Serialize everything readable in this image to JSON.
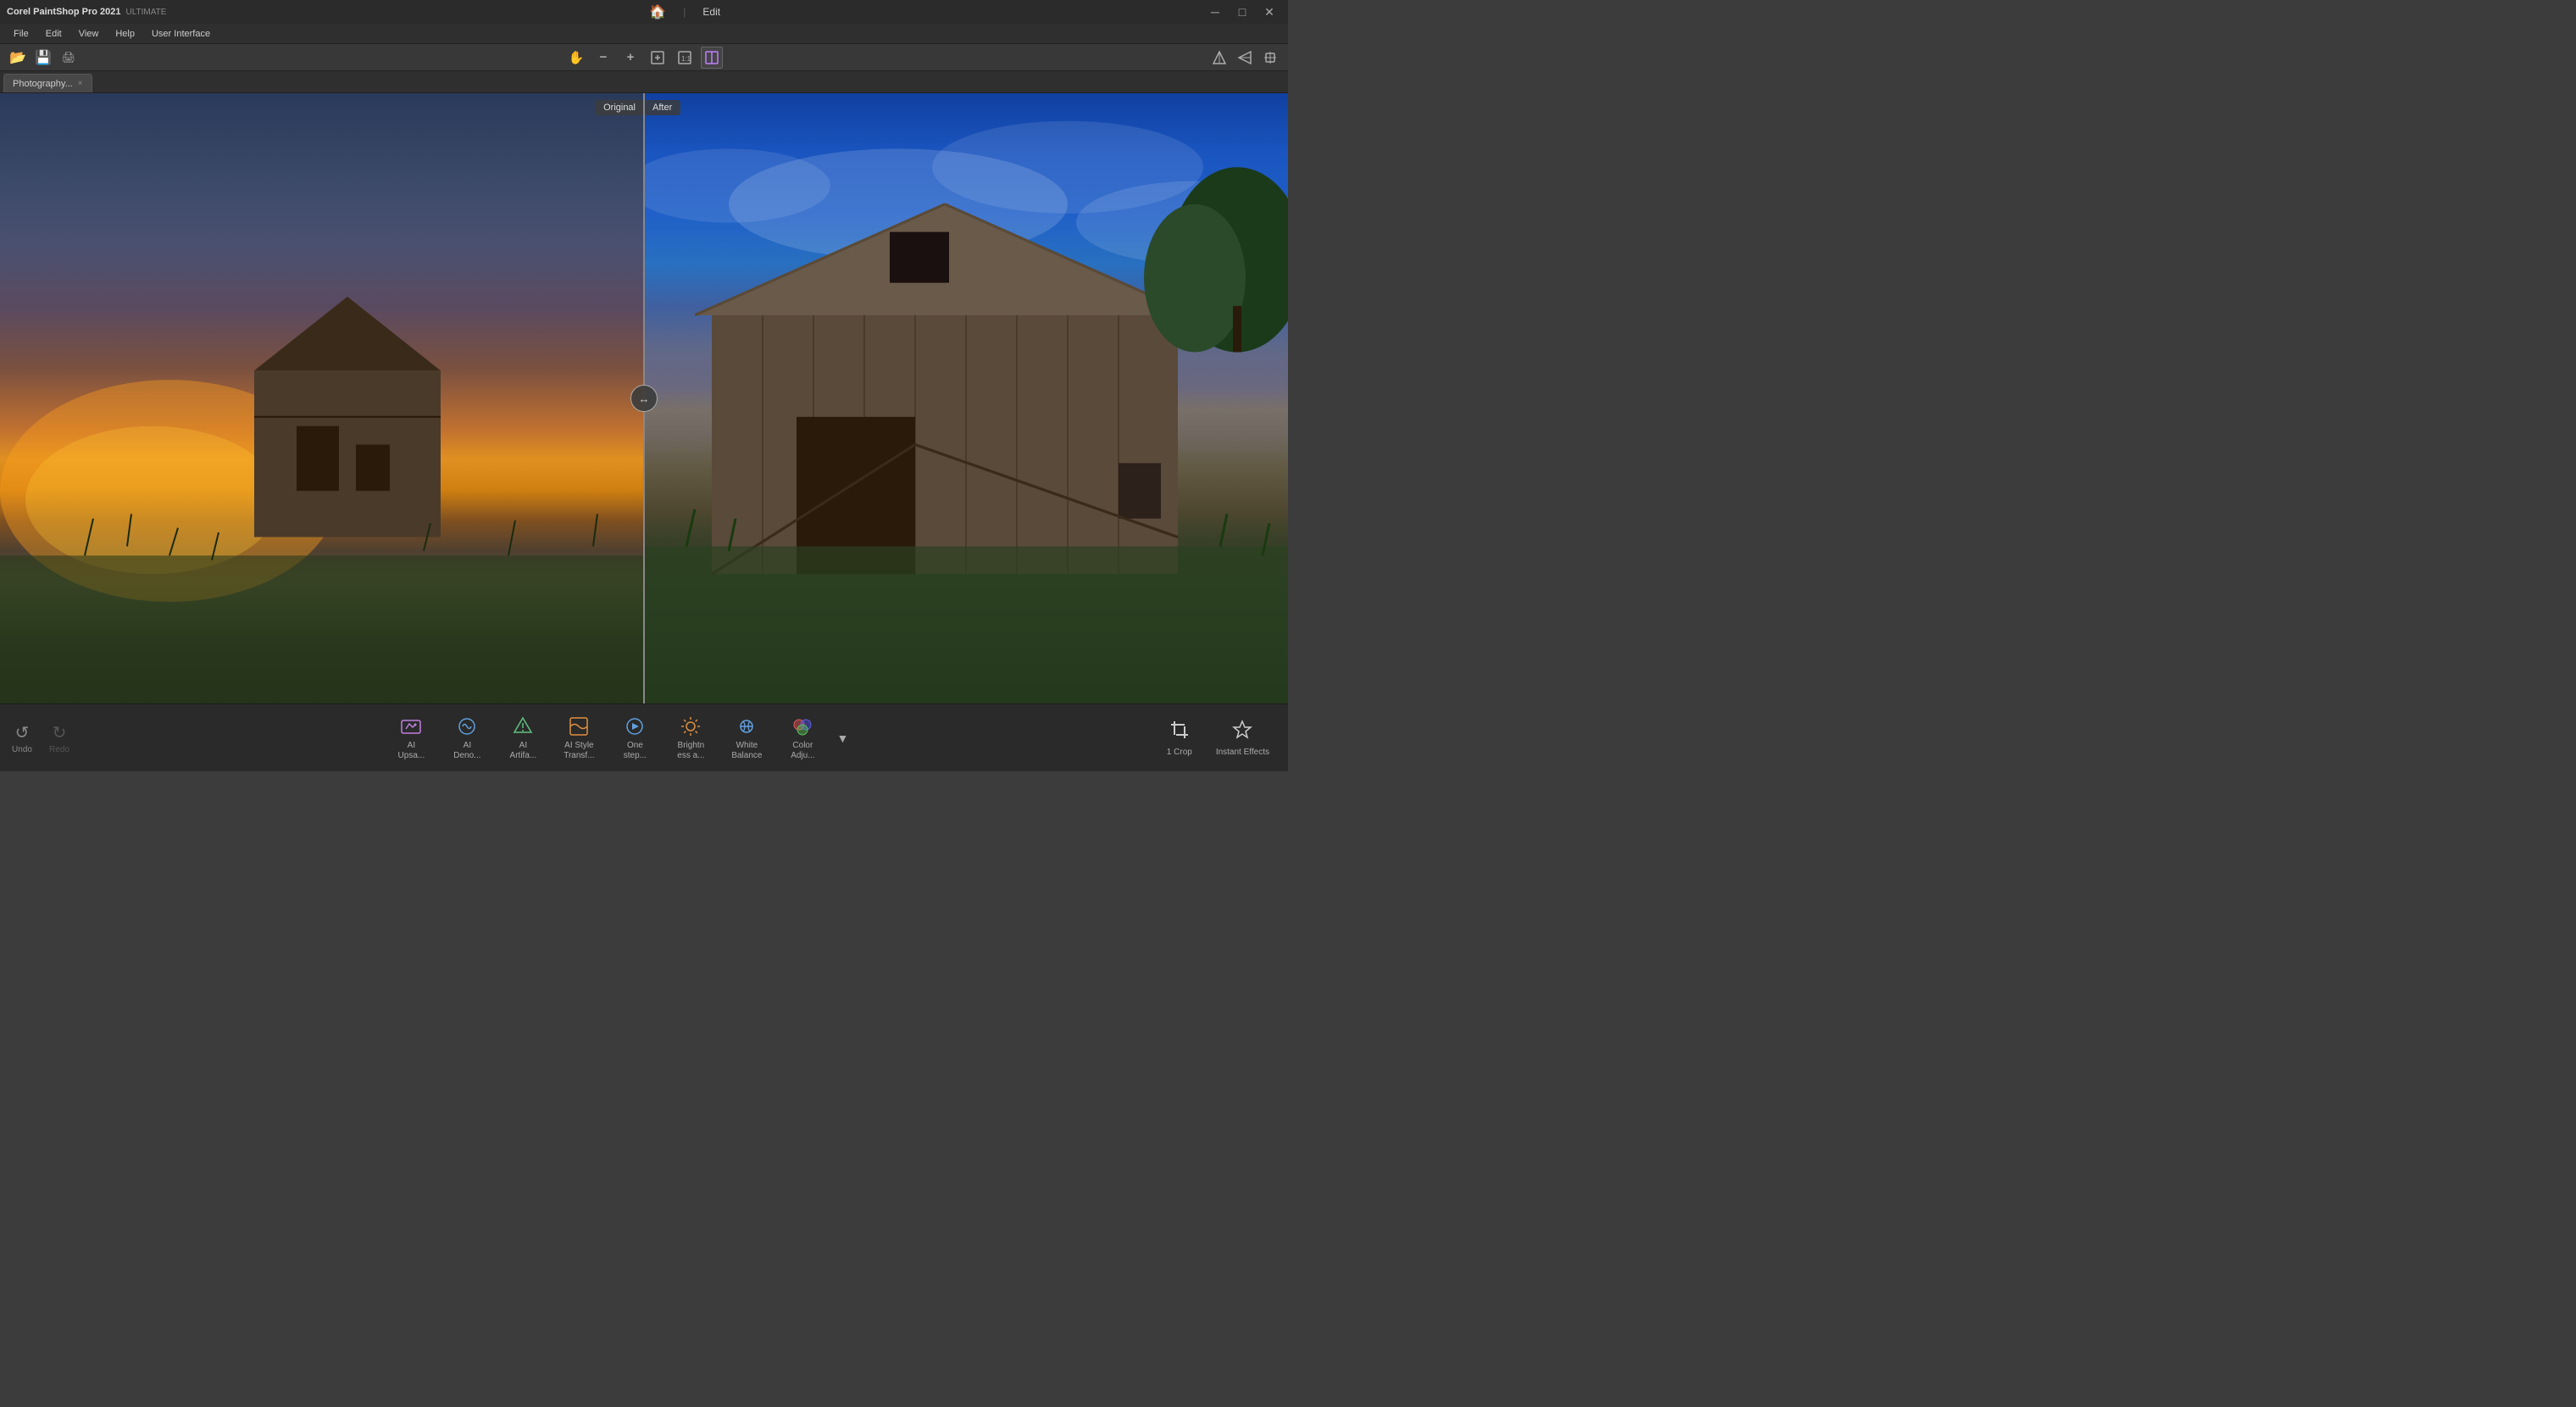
{
  "app": {
    "title": "Corel PaintShop Pro 2021",
    "subtitle": "ULTIMATE",
    "brand": "Corel PaintShop Pro 2021",
    "edition": "ULTIMATE"
  },
  "titlebar": {
    "home_icon": "🏠",
    "divider": "|",
    "edit_label": "Edit",
    "minimize": "─",
    "restore": "□",
    "close": "✕"
  },
  "menubar": {
    "items": [
      "File",
      "Edit",
      "View",
      "Help",
      "User Interface"
    ]
  },
  "toolbar": {
    "tools": [
      {
        "name": "open-icon",
        "icon": "📂"
      },
      {
        "name": "save-icon",
        "icon": "💾"
      },
      {
        "name": "print-icon",
        "icon": "🖨"
      }
    ],
    "center_tools": [
      {
        "name": "pan-tool",
        "icon": "✋"
      },
      {
        "name": "zoom-out-tool",
        "icon": "⊖"
      },
      {
        "name": "zoom-in-tool",
        "icon": "⊕"
      },
      {
        "name": "zoom-fit-tool",
        "icon": "⊡"
      },
      {
        "name": "zoom-100-tool",
        "icon": "⊟"
      },
      {
        "name": "zoom-custom-tool",
        "icon": "⊞"
      }
    ],
    "right_tools": [
      {
        "name": "perspective-v-icon",
        "icon": "△"
      },
      {
        "name": "perspective-h-icon",
        "icon": "◁"
      },
      {
        "name": "perspective-both-icon",
        "icon": "◈"
      }
    ]
  },
  "tab": {
    "name": "Photography...",
    "close": "×"
  },
  "split_view": {
    "original_label": "Original",
    "after_label": "After",
    "divider_icon": "↔"
  },
  "bottom_toolbar": {
    "undo_label": "Undo",
    "redo_label": "Redo",
    "ai_tools": [
      {
        "name": "ai-upscale",
        "icon": "⬡",
        "label": "AI\nUpsa...",
        "color": "purple"
      },
      {
        "name": "ai-denoise",
        "icon": "⬡",
        "label": "AI\nDeno...",
        "color": "blue"
      },
      {
        "name": "ai-artifact",
        "icon": "⬡",
        "label": "AI\nArtifa...",
        "color": "green"
      },
      {
        "name": "ai-style",
        "icon": "⬡",
        "label": "AI Style\nTransf...",
        "color": "orange"
      },
      {
        "name": "one-step",
        "icon": "⬡",
        "label": "One\nstep...",
        "color": "blue"
      },
      {
        "name": "brightness",
        "icon": "⬡",
        "label": "Brightn\ness a...",
        "color": "orange"
      },
      {
        "name": "white-balance",
        "icon": "⬡",
        "label": "White\nBalance",
        "color": "blue"
      },
      {
        "name": "color-adjust",
        "icon": "⬡",
        "label": "Color\nAdju...",
        "color": "purple"
      }
    ],
    "more_icon": "▼",
    "crop_label": "1 Crop",
    "instant_effects_label": "Instant Effects"
  }
}
